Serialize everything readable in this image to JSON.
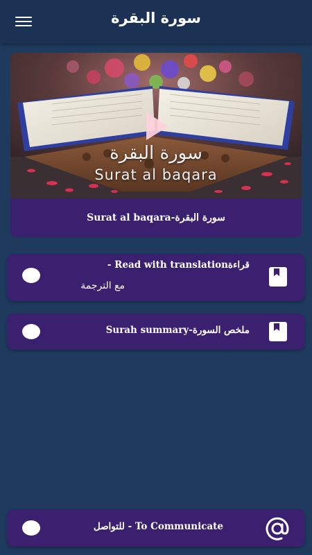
{
  "appbar": {
    "title": "سورة البقرة",
    "menu_icon": "hamburger-menu-icon"
  },
  "video": {
    "thumbnail_text_arabic": "سورة البقرة",
    "thumbnail_text_english": "Surat al baqara",
    "play_icon": "play-icon",
    "caption": "Surat al baqara-سورة البقرة"
  },
  "menu": {
    "items": [
      {
        "label_line1": "- Read with translationقراءة",
        "label_line2": "مع الترجمة",
        "icon": "bookmark-book-icon"
      },
      {
        "label_line1": "Surah summary-ملخص السورة",
        "icon": "bookmark-book-icon"
      }
    ],
    "contact": {
      "label": "للتواصل - To Communicate",
      "icon": "at-sign-icon"
    }
  },
  "colors": {
    "background": "#1e3b5e",
    "appbar": "#1b3255",
    "card": "#3b2070",
    "text": "#ffffff"
  }
}
